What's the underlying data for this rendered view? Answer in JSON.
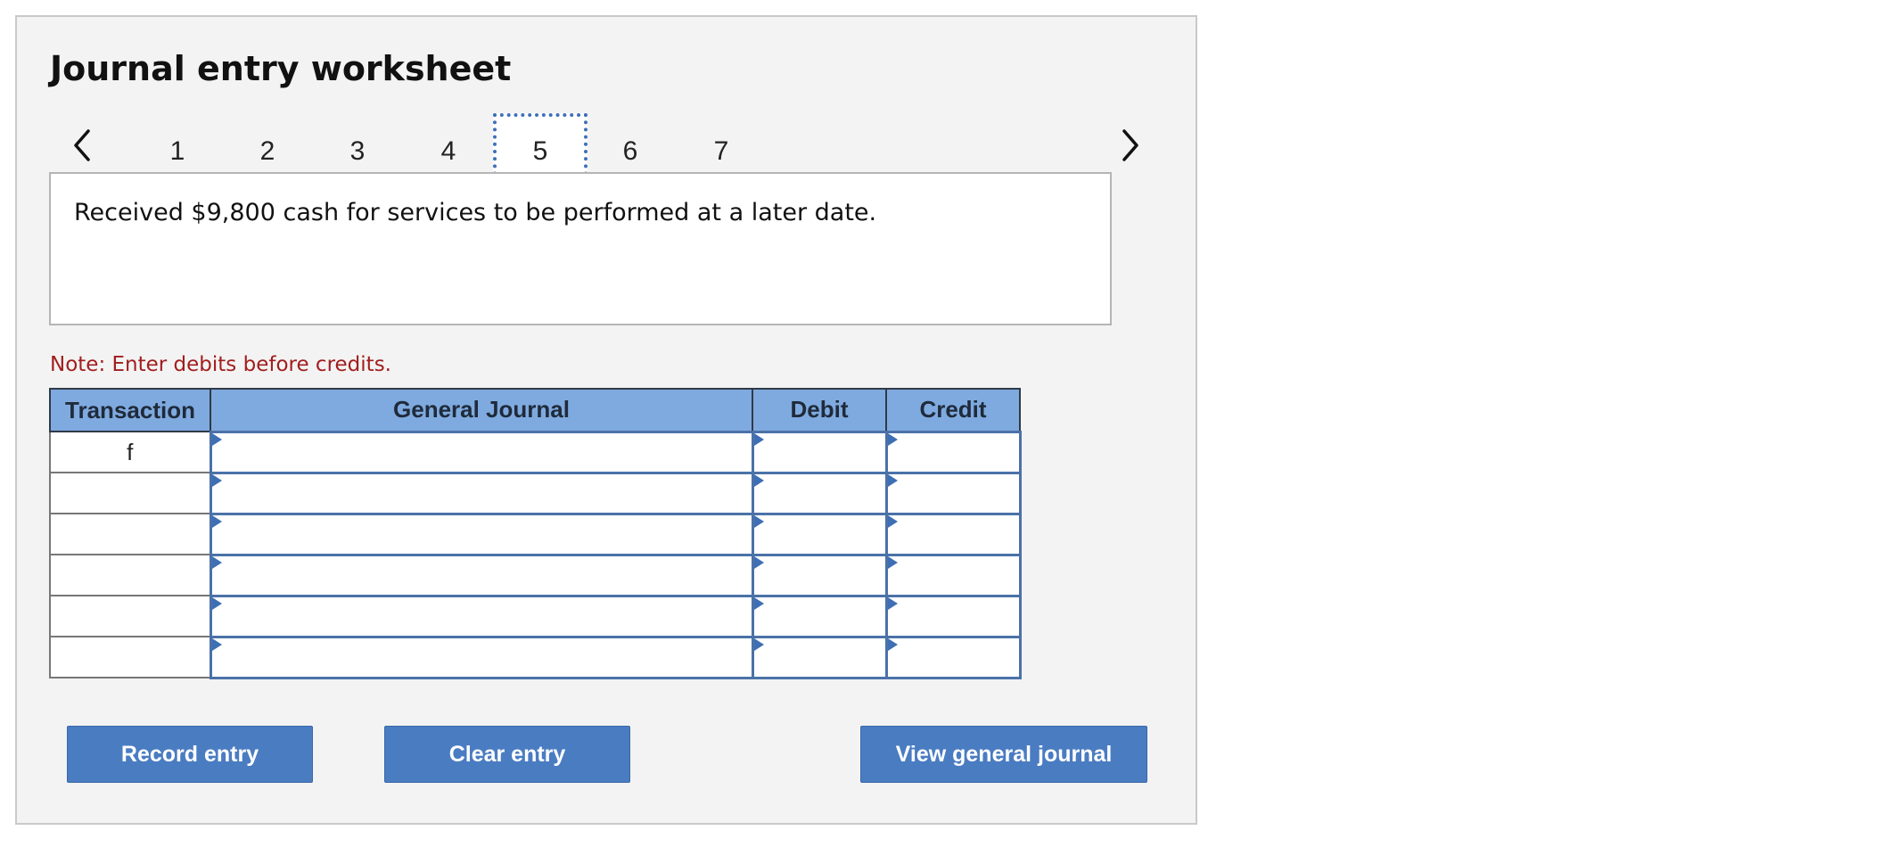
{
  "worksheet": {
    "title": "Journal entry worksheet",
    "prev_icon": "chevron-left-icon",
    "next_icon": "chevron-right-icon",
    "steps": [
      "1",
      "2",
      "3",
      "4",
      "5",
      "6",
      "7"
    ],
    "active_step": "5",
    "description": "Received $9,800 cash for services to be performed at a later date.",
    "note": "Note: Enter debits before credits."
  },
  "table": {
    "headers": {
      "transaction": "Transaction",
      "general_journal": "General Journal",
      "debit": "Debit",
      "credit": "Credit"
    },
    "rows": [
      {
        "transaction": "f",
        "account": "",
        "debit": "",
        "credit": ""
      },
      {
        "transaction": "",
        "account": "",
        "debit": "",
        "credit": ""
      },
      {
        "transaction": "",
        "account": "",
        "debit": "",
        "credit": ""
      },
      {
        "transaction": "",
        "account": "",
        "debit": "",
        "credit": ""
      },
      {
        "transaction": "",
        "account": "",
        "debit": "",
        "credit": ""
      },
      {
        "transaction": "",
        "account": "",
        "debit": "",
        "credit": ""
      }
    ]
  },
  "buttons": {
    "record": "Record entry",
    "clear": "Clear entry",
    "view": "View general journal"
  },
  "colors": {
    "panel_bg": "#f3f3f3",
    "header_bg": "#7faae0",
    "button_bg": "#4a7cc2",
    "note_text": "#a11e1e",
    "active_step_border": "#3f70b8"
  }
}
